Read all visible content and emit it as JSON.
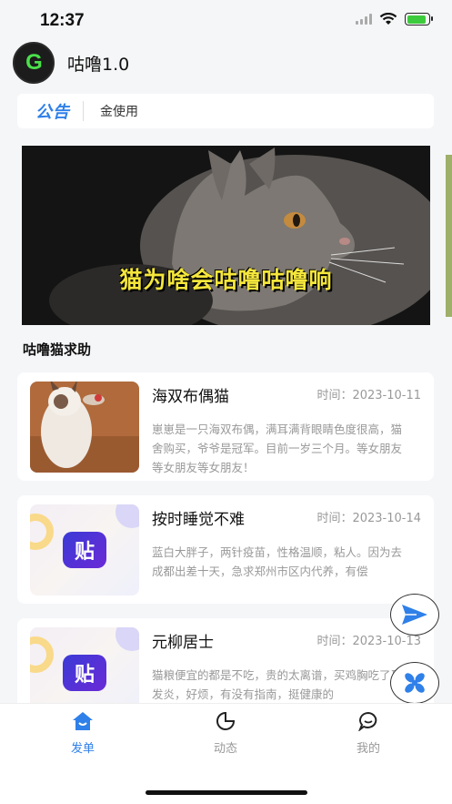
{
  "status_bar": {
    "time": "12:37"
  },
  "header": {
    "logo_text": "G",
    "title": "咕噜1.0"
  },
  "notice": {
    "tag": "公告",
    "text": "金使用"
  },
  "banner": {
    "caption": "猫为啥会咕噜咕噜响"
  },
  "section_title": "咕噜猫求助",
  "posts": [
    {
      "name": "海双布偶猫",
      "time": "时间：2023-10-11",
      "desc": "崽崽是一只海双布偶，满耳满背眼睛色度很高，猫舍购买，爷爷是冠军。目前一岁三个月。等女朋友等女朋友等女朋友！"
    },
    {
      "name": "按时睡觉不难",
      "time": "时间：2023-10-14",
      "desc": "蓝白大胖子，两针疫苗，性格温顺，粘人。因为去成都出差十天，急求郑州市区内代养，有偿",
      "thumb_text": "贴"
    },
    {
      "name": "元柳居士",
      "time": "时间：2023-10-13",
      "desc": "猫粮便宜的都是不吃，贵的太离谱，买鸡胸吃了又发炎，好烦，有没有指南，挺健康的",
      "thumb_text": "贴"
    }
  ],
  "tabs": [
    {
      "label": "发单",
      "icon": "home-icon",
      "active": true
    },
    {
      "label": "动态",
      "icon": "moon-icon",
      "active": false
    },
    {
      "label": "我的",
      "icon": "chat-icon",
      "active": false
    }
  ],
  "colors": {
    "accent": "#2f80e8",
    "background": "#f5f6f8"
  }
}
